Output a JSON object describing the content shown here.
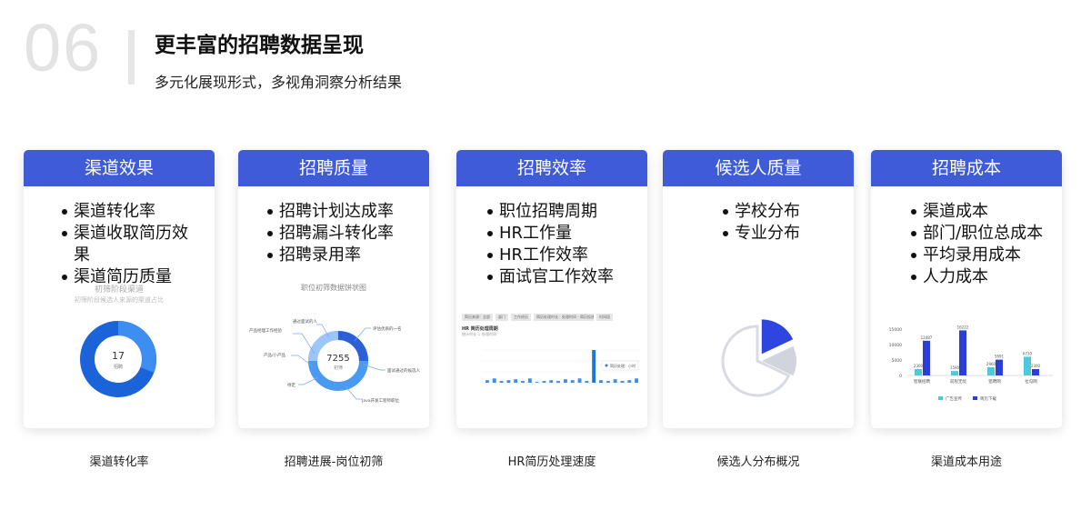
{
  "header": {
    "number": "06",
    "title": "更丰富的招聘数据呈现",
    "subtitle": "多元化展现形式，多视角洞察分析结果"
  },
  "cards": [
    {
      "head": "渠道效果",
      "bullets": [
        "渠道转化率",
        "渠道收取简历效果",
        "渠道简历质量"
      ],
      "caption": "渠道转化率",
      "chart": {
        "title": "初筛阶段渠道",
        "subtitle": "初筛阶段候选人来源的渠道占比",
        "center_value": "17",
        "center_label": "招聘",
        "segments": [
          0.7,
          0.3
        ]
      }
    },
    {
      "head": "招聘质量",
      "bullets": [
        "招聘计划达成率",
        "招聘漏斗转化率",
        "招聘录用率"
      ],
      "caption": "招聘进展-岗位初筛",
      "chart": {
        "title": "职位初筛数据饼状图",
        "center_value": "7255",
        "center_label": "初筛",
        "labels": [
          "通过面试的人",
          "产品经理工作经验",
          "评估优质的一名",
          "产品/小产品",
          "面试通过的候选人",
          "待定",
          "Java开发工程师职位"
        ]
      }
    },
    {
      "head": "招聘效率",
      "bullets": [
        "职位招聘周期",
        "HR工作量",
        "HR工作效率",
        "面试官工作效率"
      ],
      "caption": "HR简历处理速度",
      "chart": {
        "filters": [
          "简历来源：全部",
          "部门",
          "工作经历",
          "简历处理时长：处理时间 - 简历投递时间",
          "时间段"
        ],
        "title": "HR 简历处理周期",
        "subtitle": "统计时长 = 处理时间",
        "tooltip": "简历处理：小时",
        "values": [
          3,
          5,
          2,
          3,
          4,
          2,
          5,
          1,
          2,
          3,
          2,
          4,
          3,
          5,
          2,
          38,
          3,
          2,
          4,
          2,
          3,
          5
        ]
      }
    },
    {
      "head": "候选人质量",
      "bullets": [
        "学校分布",
        "专业分布"
      ],
      "caption": "候选人分布概况",
      "chart": {
        "type": "pie",
        "slices": [
          0.18,
          0.14,
          0.68
        ]
      }
    },
    {
      "head": "招聘成本",
      "bullets": [
        "渠道成本",
        "部门/职位总成本",
        "平均录用成本",
        "人力成本"
      ],
      "caption": "渠道成本用途",
      "chart": {
        "type": "bar",
        "categories": [
          "智联招聘",
          "前程无忧",
          "猎聘网",
          "拉勾网"
        ],
        "series": [
          {
            "name": "广告宣传",
            "values": [
              2300,
              1590,
              2960,
              6730
            ]
          },
          {
            "name": "简历下载",
            "values": [
              12487,
              16222,
              5691,
              2300
            ]
          }
        ],
        "yticks": [
          "15000",
          "10000",
          "5000",
          "0"
        ],
        "ylim": [
          0,
          17000
        ],
        "colors": {
          "ad": "#4ec9dc",
          "resume": "#2b3fd6"
        }
      }
    }
  ]
}
